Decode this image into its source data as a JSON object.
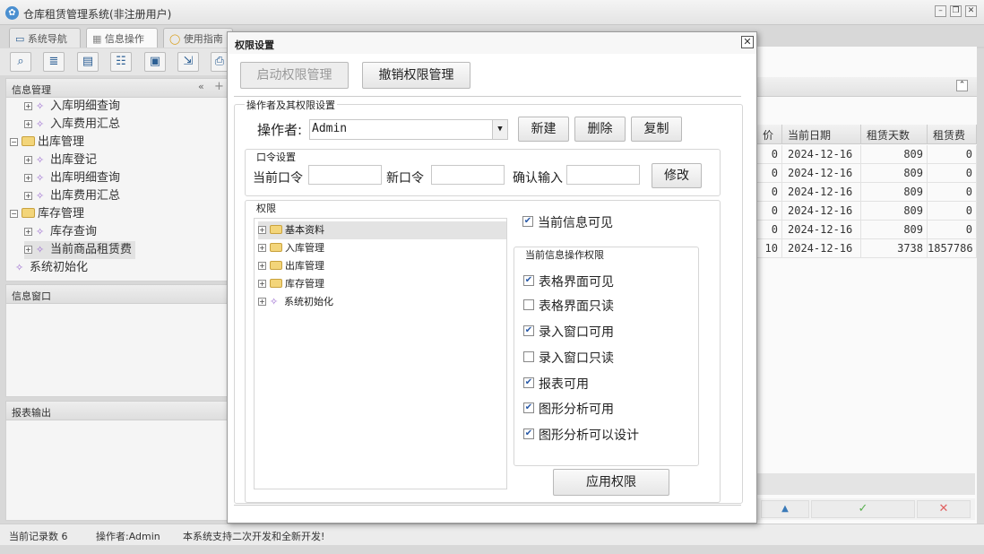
{
  "app": {
    "title": "仓库租赁管理系统(非注册用户)"
  },
  "tabs": [
    {
      "label": "系统导航"
    },
    {
      "label": "信息操作"
    },
    {
      "label": "使用指南"
    }
  ],
  "left": {
    "info_mgmt_title": "信息管理",
    "tree": [
      {
        "label": "入库明细查询",
        "kind": "leaf",
        "indent": 2
      },
      {
        "label": "入库费用汇总",
        "kind": "leaf",
        "indent": 2
      },
      {
        "label": "出库管理",
        "kind": "folder",
        "indent": 1
      },
      {
        "label": "出库登记",
        "kind": "leaf",
        "indent": 2
      },
      {
        "label": "出库明细查询",
        "kind": "leaf",
        "indent": 2
      },
      {
        "label": "出库费用汇总",
        "kind": "leaf",
        "indent": 2
      },
      {
        "label": "库存管理",
        "kind": "folder",
        "indent": 1
      },
      {
        "label": "库存查询",
        "kind": "leaf",
        "indent": 2
      },
      {
        "label": "当前商品租赁费",
        "kind": "leaf",
        "indent": 2
      },
      {
        "label": "系统初始化",
        "kind": "root",
        "indent": 1
      }
    ],
    "info_window_title": "信息窗口",
    "report_title": "报表输出"
  },
  "grid": {
    "headers": [
      "价",
      "当前日期",
      "租赁天数",
      "租赁费"
    ],
    "rows": [
      [
        "0",
        "2024-12-16",
        "809",
        "0"
      ],
      [
        "0",
        "2024-12-16",
        "809",
        "0"
      ],
      [
        "0",
        "2024-12-16",
        "809",
        "0"
      ],
      [
        "0",
        "2024-12-16",
        "809",
        "0"
      ],
      [
        "0",
        "2024-12-16",
        "809",
        "0"
      ],
      [
        "10",
        "2024-12-16",
        "3738",
        "1857786"
      ]
    ],
    "footer_icons": [
      "up-arrow-icon",
      "check-icon",
      "cross-icon"
    ]
  },
  "status": {
    "records": "当前记录数 6",
    "operator": "操作者:Admin",
    "note": "本系统支持二次开发和全新开发!"
  },
  "dialog": {
    "title": "权限设置",
    "enable_btn": "启动权限管理",
    "revoke_btn": "撤销权限管理",
    "operator_group": "操作者及其权限设置",
    "operator_label": "操作者:",
    "operator_value": "Admin",
    "new_btn": "新建",
    "delete_btn": "删除",
    "copy_btn": "复制",
    "password_group": "口令设置",
    "current_pwd": "当前口令",
    "new_pwd": "新口令",
    "confirm_pwd": "确认输入",
    "modify_btn": "修改",
    "perm_group": "权限",
    "perm_tree": [
      {
        "label": "基本资料",
        "kind": "folder"
      },
      {
        "label": "入库管理",
        "kind": "folder"
      },
      {
        "label": "出库管理",
        "kind": "folder"
      },
      {
        "label": "库存管理",
        "kind": "folder"
      },
      {
        "label": "系统初始化",
        "kind": "leaf"
      }
    ],
    "current_visible": {
      "label": "当前信息可见",
      "checked": true
    },
    "ops_group": "当前信息操作权限",
    "ops": [
      {
        "label": "表格界面可见",
        "checked": true
      },
      {
        "label": "表格界面只读",
        "checked": false
      },
      {
        "label": "录入窗口可用",
        "checked": true
      },
      {
        "label": "录入窗口只读",
        "checked": false
      },
      {
        "label": "报表可用",
        "checked": true
      },
      {
        "label": "图形分析可用",
        "checked": true
      },
      {
        "label": "图形分析可以设计",
        "checked": true
      }
    ],
    "apply_btn": "应用权限"
  }
}
